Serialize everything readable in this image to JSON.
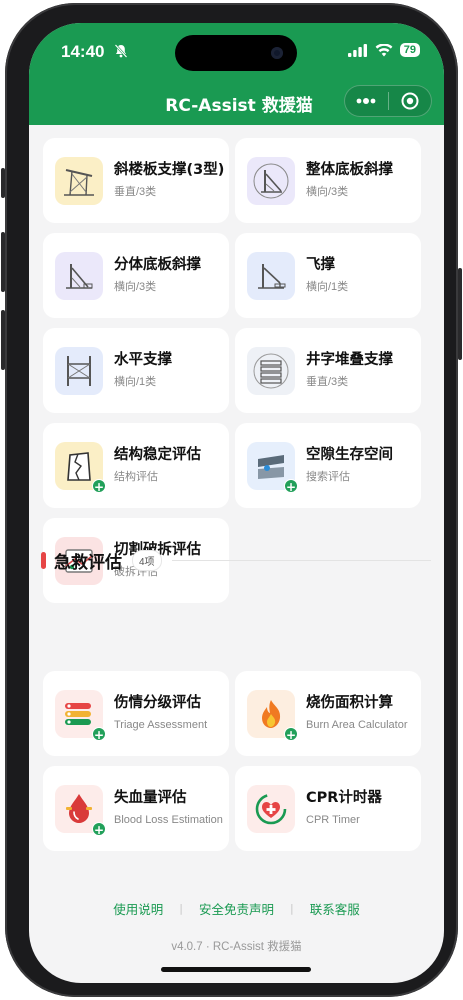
{
  "status_bar": {
    "time": "14:40",
    "battery": "79"
  },
  "header": {
    "title": "RC-Assist 救援猫"
  },
  "shoring_cards": [
    {
      "title": "斜楼板支撑(3型)",
      "subtitle": "垂直/3类"
    },
    {
      "title": "整体底板斜撑",
      "subtitle": "横向/3类"
    },
    {
      "title": "分体底板斜撑",
      "subtitle": "横向/3类"
    },
    {
      "title": "飞撑",
      "subtitle": "横向/1类"
    },
    {
      "title": "水平支撑",
      "subtitle": "横向/1类"
    },
    {
      "title": "井字堆叠支撑",
      "subtitle": "垂直/3类"
    },
    {
      "title": "结构稳定评估",
      "subtitle": "结构评估"
    },
    {
      "title": "空隙生存空间",
      "subtitle": "搜索评估"
    },
    {
      "title": "切割破拆评估",
      "subtitle": "破拆评估"
    }
  ],
  "first_aid": {
    "section_title": "急救评估",
    "count_badge": "4项",
    "cards": [
      {
        "title": "伤情分级评估",
        "subtitle": "Triage Assessment"
      },
      {
        "title": "烧伤面积计算",
        "subtitle": "Burn Area Calculator"
      },
      {
        "title": "失血量评估",
        "subtitle": "Blood Loss Estimation"
      },
      {
        "title": "CPR计时器",
        "subtitle": "CPR Timer"
      }
    ]
  },
  "footer": {
    "links": [
      "使用说明",
      "安全免责声明",
      "联系客服"
    ],
    "version": "v4.0.7 · RC-Assist 救援猫"
  },
  "colors": {
    "brand_green": "#1a9a52",
    "accent_red": "#e64545"
  }
}
